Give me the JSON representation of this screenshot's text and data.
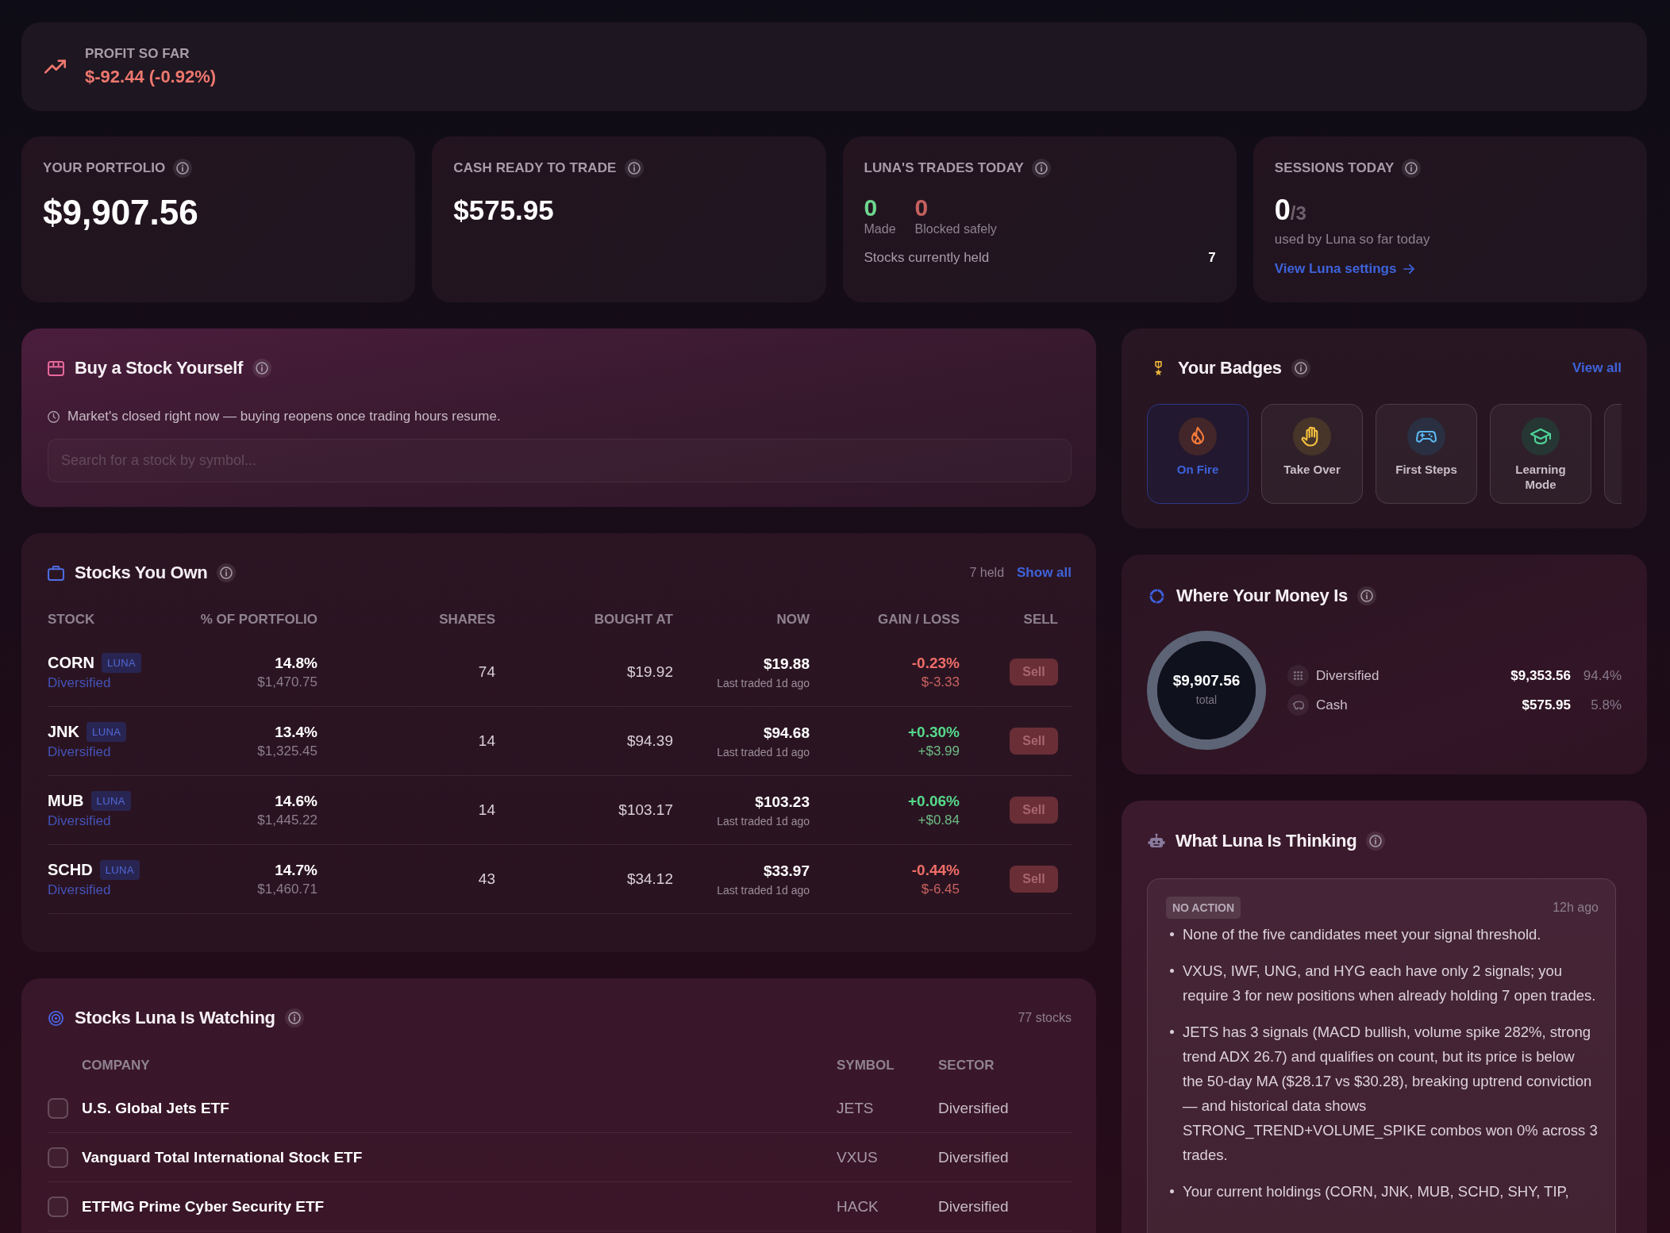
{
  "profit": {
    "label": "PROFIT SO FAR",
    "value": "$-92.44 (-0.92%)",
    "loss": true
  },
  "stats": [
    {
      "kind": "hero",
      "label": "YOUR PORTFOLIO",
      "value": "$9,907.56"
    },
    {
      "kind": "value",
      "label": "CASH READY TO TRADE",
      "value": "$575.95"
    },
    {
      "kind": "trades",
      "label": "LUNA'S TRADES TODAY",
      "counts": [
        {
          "value": "0",
          "label": "Made",
          "color": "#6dd88f"
        },
        {
          "value": "0",
          "label": "Blocked safely",
          "color": "#c7615f"
        }
      ],
      "held_label": "Stocks currently held",
      "held_value": "7"
    },
    {
      "kind": "sessions",
      "label": "SESSIONS TODAY",
      "used": "0",
      "limit": "/3",
      "note": "used by Luna so far today",
      "link": "View Luna settings"
    }
  ],
  "buy": {
    "title": "Buy a Stock Yourself",
    "notice": "Market's closed right now — buying reopens once trading hours resume.",
    "search": {
      "placeholder": "Search for a stock by symbol..."
    }
  },
  "holdings": {
    "title": "Stocks You Own",
    "count": "7 held",
    "link": "Show all",
    "columns": [
      "STOCK",
      "% OF PORTFOLIO",
      "SHARES",
      "BOUGHT AT",
      "NOW",
      "GAIN / LOSS",
      "SELL"
    ],
    "rows": [
      {
        "symbol": "CORN",
        "tag": "LUNA",
        "sector": "Diversified",
        "share": "14.8%",
        "amount": "$1,470.75",
        "shares": "74",
        "bought": "$19.92",
        "now": "$19.88",
        "note": "Last traded 1d ago",
        "change": "-0.23%",
        "change_amount": "$-3.33",
        "loss": true,
        "action": "Sell",
        "disabled": true
      },
      {
        "symbol": "JNK",
        "tag": "LUNA",
        "sector": "Diversified",
        "share": "13.4%",
        "amount": "$1,325.45",
        "shares": "14",
        "bought": "$94.39",
        "now": "$94.68",
        "note": "Last traded 1d ago",
        "change": "+0.30%",
        "change_amount": "+$3.99",
        "loss": false,
        "action": "Sell",
        "disabled": true
      },
      {
        "symbol": "MUB",
        "tag": "LUNA",
        "sector": "Diversified",
        "share": "14.6%",
        "amount": "$1,445.22",
        "shares": "14",
        "bought": "$103.17",
        "now": "$103.23",
        "note": "Last traded 1d ago",
        "change": "+0.06%",
        "change_amount": "+$0.84",
        "loss": false,
        "action": "Sell",
        "disabled": true
      },
      {
        "symbol": "SCHD",
        "tag": "LUNA",
        "sector": "Diversified",
        "share": "14.7%",
        "amount": "$1,460.71",
        "shares": "43",
        "bought": "$34.12",
        "now": "$33.97",
        "note": "Last traded 1d ago",
        "change": "-0.44%",
        "change_amount": "$-6.45",
        "loss": true,
        "action": "Sell",
        "disabled": true
      }
    ]
  },
  "watching": {
    "title": "Stocks Luna Is Watching",
    "count": "77 stocks",
    "columns": [
      "COMPANY",
      "SYMBOL",
      "SECTOR"
    ],
    "rows": [
      {
        "checked": false,
        "company": "U.S. Global Jets ETF",
        "symbol": "JETS",
        "sector": "Diversified"
      },
      {
        "checked": false,
        "company": "Vanguard Total International Stock ETF",
        "symbol": "VXUS",
        "sector": "Diversified"
      },
      {
        "checked": false,
        "company": "ETFMG Prime Cyber Security ETF",
        "symbol": "HACK",
        "sector": "Diversified"
      }
    ]
  },
  "badges": {
    "title": "Your Badges",
    "link": "View all",
    "items": [
      {
        "label": "On Fire",
        "selected": true
      },
      {
        "label": "Take Over",
        "selected": false
      },
      {
        "label": "First Steps",
        "selected": false
      },
      {
        "label": "Learning Mode",
        "selected": false
      }
    ],
    "more_hidden": true
  },
  "money": {
    "title": "Where Your Money Is",
    "total": "$9,907.56",
    "total_label": "total",
    "chart_data": {
      "type": "donut",
      "categories": [
        "Diversified",
        "Cash"
      ],
      "values": [
        94.4,
        5.8
      ]
    },
    "rows": [
      {
        "amount": "$9,353.56",
        "share": "94.4%"
      },
      {
        "amount": "$575.95",
        "share": "5.8%"
      }
    ]
  },
  "thinking": {
    "title": "What Luna Is Thinking",
    "entry": {
      "tag": "NO ACTION",
      "time": "12h ago",
      "bullets": [
        "None of the five candidates meet your signal threshold.",
        "VXUS, IWF, UNG, and HYG each have only 2 signals; you require 3 for new positions when already holding 7 open trades.",
        "JETS has 3 signals (MACD bullish, volume spike 282%, strong trend ADX 26.7) and qualifies on count, but its price is below the 50-day MA ($28.17 vs $30.28), breaking uptrend conviction — and historical data shows STRONG_TREND+VOLUME_SPIKE combos won 0% across 3 trades.",
        "Your current holdings (CORN, JNK, MUB, SCHD, SHY, TIP,"
      ]
    }
  }
}
